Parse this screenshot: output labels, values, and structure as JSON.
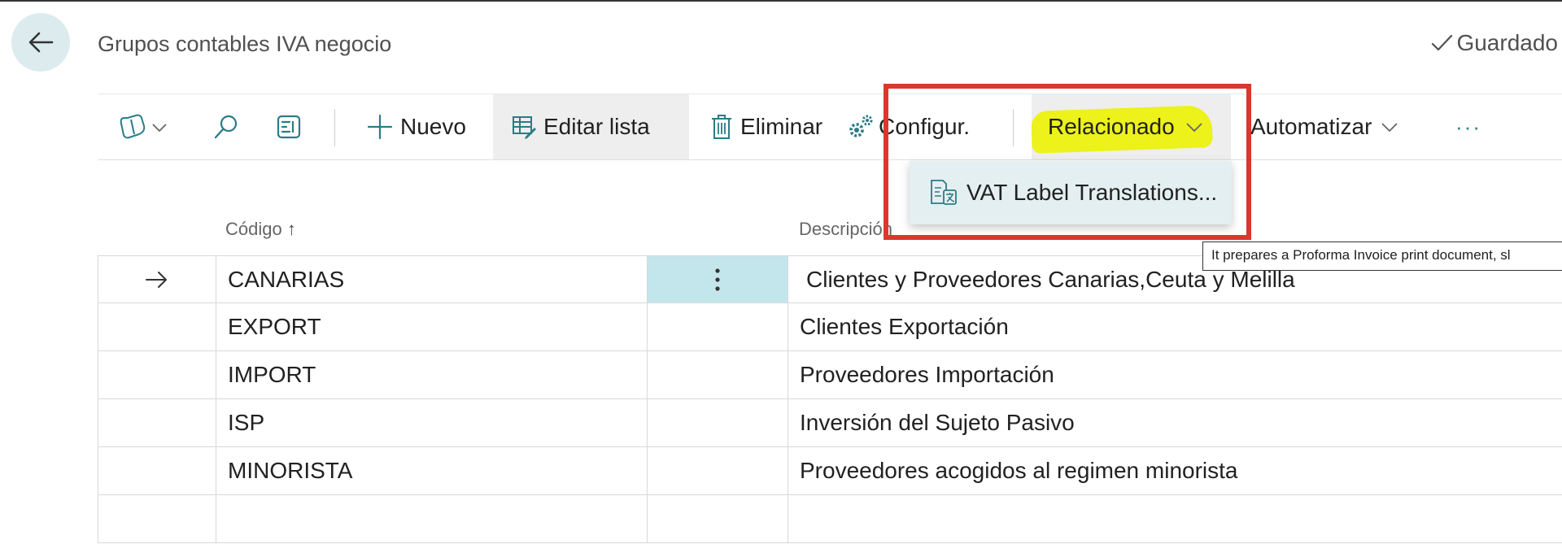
{
  "header": {
    "title": "Grupos contables IVA negocio",
    "status": "Guardado"
  },
  "toolbar": {
    "new_label": "Nuevo",
    "edit_list_label": "Editar lista",
    "delete_label": "Eliminar",
    "configure_label": "Configur.",
    "related_label": "Relacionado",
    "automate_label": "Automatizar",
    "more_label": "···"
  },
  "related_menu": {
    "items": [
      {
        "label": "VAT Label Translations..."
      }
    ]
  },
  "tooltip": {
    "text": "It prepares a Proforma Invoice print document, sl"
  },
  "table": {
    "columns": [
      {
        "label": "Código",
        "sort": "↑"
      },
      {
        "label": "Descripción"
      }
    ],
    "rows": [
      {
        "code": "CANARIAS",
        "description": "Clientes y Proveedores Canarias,Ceuta y Melilla",
        "selected": true
      },
      {
        "code": "EXPORT",
        "description": "Clientes Exportación"
      },
      {
        "code": "IMPORT",
        "description": "Proveedores Importación"
      },
      {
        "code": "ISP",
        "description": "Inversión del Sujeto Pasivo"
      },
      {
        "code": "MINORISTA",
        "description": "Proveedores acogidos al regimen minorista"
      },
      {
        "code": "",
        "description": ""
      }
    ]
  },
  "colors": {
    "accent": "#2b7c86",
    "back_button_bg": "#dcebee",
    "selected_cell": "#c3e6ec",
    "annotation_box": "#d9382b",
    "annotation_highlight": "#ecf21a"
  }
}
